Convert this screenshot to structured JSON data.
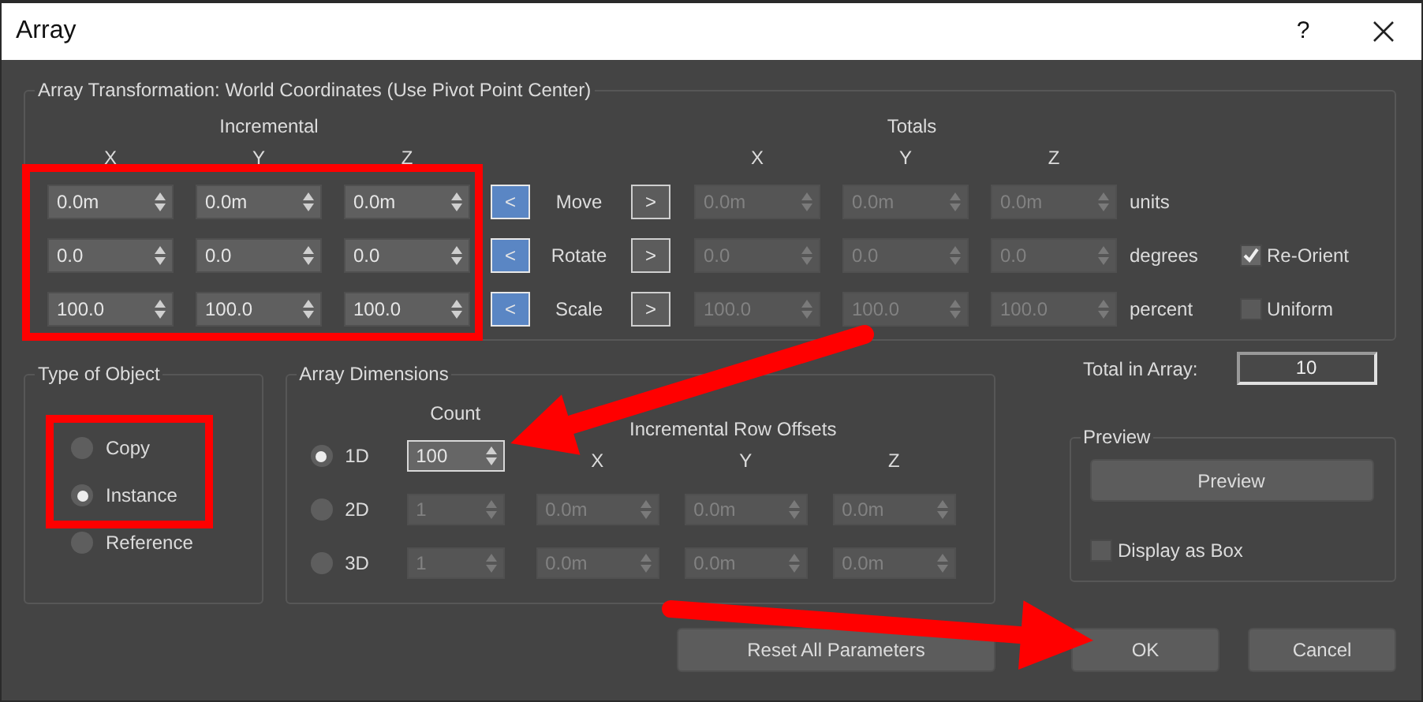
{
  "window": {
    "title": "Array",
    "help": "?"
  },
  "transformation": {
    "title": "Array Transformation: World Coordinates (Use Pivot Point Center)",
    "incremental_heading": "Incremental",
    "totals_heading": "Totals",
    "incremental_axes": [
      "X",
      "Y",
      "Z"
    ],
    "totals_axes": [
      "X",
      "Y",
      "Z"
    ],
    "rows": [
      {
        "label": "Move",
        "incremental": [
          "0.0m",
          "0.0m",
          "0.0m"
        ],
        "to_incremental": {
          "text": "<",
          "on": true
        },
        "to_totals": {
          "text": ">",
          "on": false
        },
        "totals": [
          "0.0m",
          "0.0m",
          "0.0m"
        ],
        "totals_disabled": true,
        "unit": "units"
      },
      {
        "label": "Rotate",
        "incremental": [
          "0.0",
          "0.0",
          "0.0"
        ],
        "to_incremental": {
          "text": "<",
          "on": true
        },
        "to_totals": {
          "text": ">",
          "on": false
        },
        "totals": [
          "0.0",
          "0.0",
          "0.0"
        ],
        "totals_disabled": true,
        "unit": "degrees",
        "option": {
          "label": "Re-Orient",
          "checked": true
        }
      },
      {
        "label": "Scale",
        "incremental": [
          "100.0",
          "100.0",
          "100.0"
        ],
        "to_incremental": {
          "text": "<",
          "on": true
        },
        "to_totals": {
          "text": ">",
          "on": false
        },
        "totals": [
          "100.0",
          "100.0",
          "100.0"
        ],
        "totals_disabled": true,
        "unit": "percent",
        "option": {
          "label": "Uniform",
          "checked": false
        }
      }
    ]
  },
  "type_of_object": {
    "title": "Type of Object",
    "options": [
      {
        "label": "Copy",
        "selected": false
      },
      {
        "label": "Instance",
        "selected": true
      },
      {
        "label": "Reference",
        "selected": false
      }
    ]
  },
  "array_dimensions": {
    "title": "Array Dimensions",
    "count_heading": "Count",
    "offsets_heading": "Incremental Row Offsets",
    "axes": [
      "X",
      "Y",
      "Z"
    ],
    "rows": [
      {
        "label": "1D",
        "selected": true,
        "count": "100",
        "focused": true,
        "disabled": false
      },
      {
        "label": "2D",
        "selected": false,
        "count": "1",
        "focused": false,
        "disabled": true,
        "offsets": [
          "0.0m",
          "0.0m",
          "0.0m"
        ]
      },
      {
        "label": "3D",
        "selected": false,
        "count": "1",
        "focused": false,
        "disabled": true,
        "offsets": [
          "0.0m",
          "0.0m",
          "0.0m"
        ]
      }
    ]
  },
  "total_in_array": {
    "label": "Total in Array:",
    "value": "10"
  },
  "preview": {
    "title": "Preview",
    "button": "Preview",
    "display_as_box": {
      "label": "Display as Box",
      "checked": false
    }
  },
  "buttons": [
    {
      "label": "Reset All Parameters"
    },
    {
      "label": "OK"
    },
    {
      "label": "Cancel"
    }
  ],
  "annotations": [
    {
      "kind": "box"
    },
    {
      "kind": "box"
    },
    {
      "kind": "arrow"
    },
    {
      "kind": "arrow"
    }
  ]
}
